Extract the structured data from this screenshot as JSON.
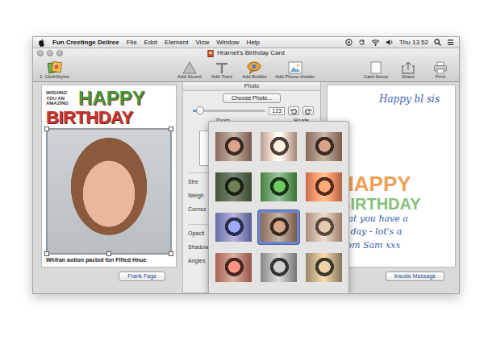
{
  "menubar": {
    "app": "Fun Creetinge Deliree",
    "menus": [
      "File",
      "Edot",
      "Element",
      "Vicw",
      "Window",
      "Help"
    ],
    "clock": "Thu 13 52"
  },
  "window": {
    "title": "Hrarnet's Birthday Card"
  },
  "toolbar": {
    "styles": "1: ClothStyles",
    "tools": [
      "Add Stuent",
      "Add Trant",
      "Add Buldlor",
      "Add Phono Holder"
    ],
    "actions": [
      "Card Setup",
      "Share",
      "Print"
    ]
  },
  "front_page": {
    "tagline": "WISHING YOU AN AMAZING",
    "heading": [
      "HAPPY",
      "BIRTHDAY"
    ],
    "caption": "Whfran aotion pacted fon Flfied Hnue",
    "button": "Frank Fage"
  },
  "photo_panel": {
    "title": "Photo",
    "choose_button": "Choose Photo...",
    "zoom": {
      "level": 0.1,
      "value": "123"
    },
    "zoom_label": "Zoom",
    "rotate_label": "Roate",
    "labels": [
      "Stre",
      "Weigh",
      "Cornez",
      "Opacit",
      "Shadow",
      "Angles"
    ]
  },
  "filters": [
    {
      "selected": false
    },
    {
      "selected": false
    },
    {
      "selected": false
    },
    {
      "selected": false
    },
    {
      "selected": false
    },
    {
      "selected": false
    },
    {
      "selected": false
    },
    {
      "selected": true
    },
    {
      "selected": false
    },
    {
      "selected": false
    },
    {
      "selected": false
    },
    {
      "selected": false
    }
  ],
  "inside_page": {
    "greeting": "Happy bl sis",
    "heading": [
      "HAPPY",
      "BIRTHDAY"
    ],
    "lines": [
      "that you have a",
      "at day - lot's a",
      "from Sam xxx"
    ],
    "button": "Insode Message"
  }
}
